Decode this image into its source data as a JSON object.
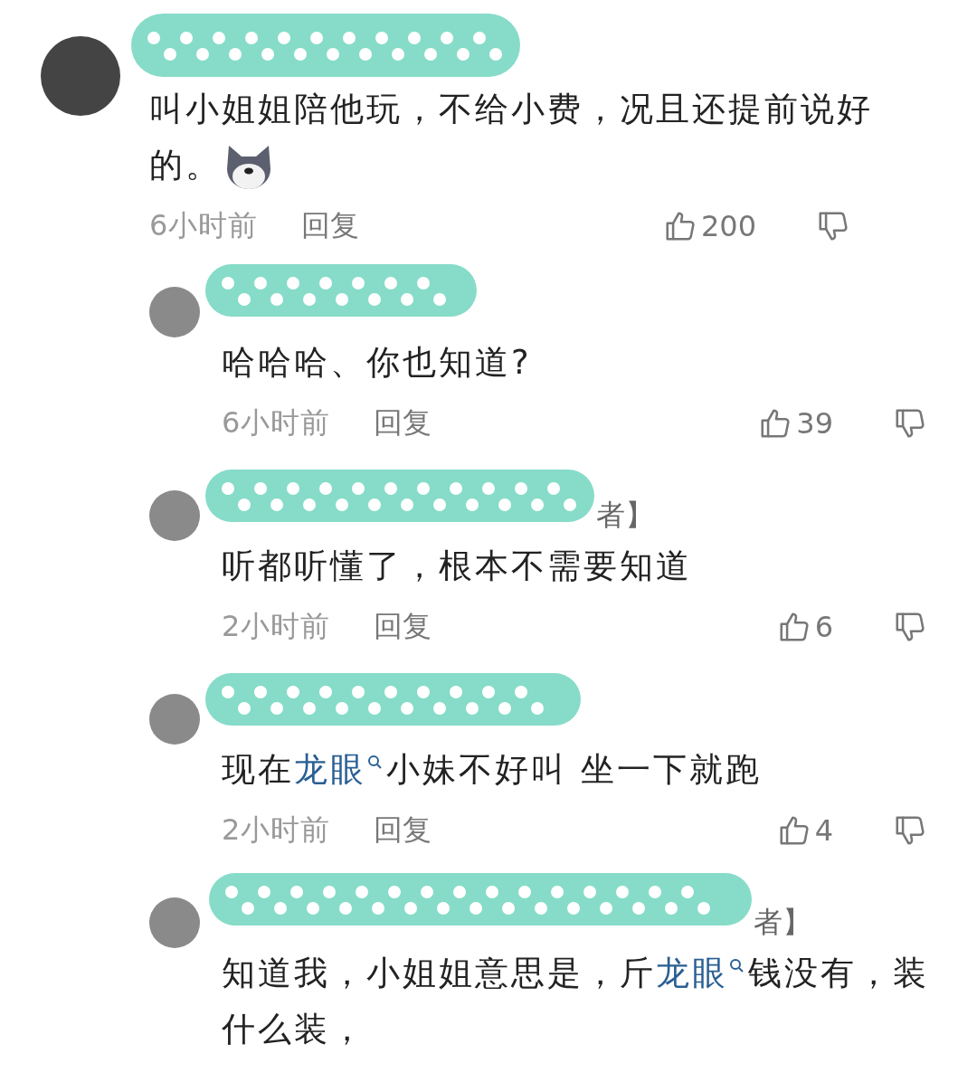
{
  "comment": {
    "text": [
      {
        "text": "叫小姐姐陪他玩，不给小费，况且还提前说好的。"
      }
    ],
    "emoji": true,
    "time": "6小时前",
    "reply": "回复",
    "likes": "200",
    "replies": [
      {
        "text": [
          {
            "text": "哈哈哈、你也知道?"
          }
        ],
        "time": "6小时前",
        "reply": "回复",
        "likes": "39"
      },
      {
        "name_fragment": "者】",
        "text": [
          {
            "text": "听都听懂了，根本不需要知道"
          }
        ],
        "time": "2小时前",
        "reply": "回复",
        "likes": "6"
      },
      {
        "text": [
          {
            "text": "现在"
          },
          {
            "text": "龙眼",
            "kind": "link"
          },
          {
            "text": "小妹不好叫  坐一下就跑"
          }
        ],
        "time": "2小时前",
        "reply": "回复",
        "likes": "4"
      },
      {
        "name_fragment": "者】",
        "text": [
          {
            "text": "知道我，小姐姐意思是，斤"
          },
          {
            "text": "龙眼",
            "kind": "link"
          },
          {
            "text": "钱没有，装什么装，"
          }
        ]
      }
    ]
  }
}
